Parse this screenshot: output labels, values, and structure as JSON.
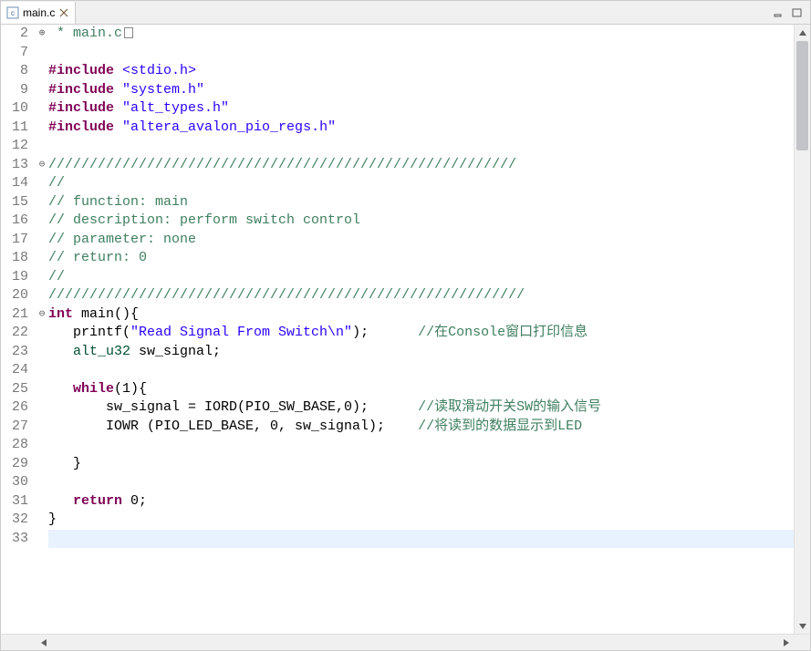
{
  "tab": {
    "filename": "main.c"
  },
  "code": {
    "lines": [
      {
        "n": "2",
        "fold": "plus",
        "tokens": [
          {
            "c": "comment",
            "t": " * main.c"
          }
        ],
        "box": true
      },
      {
        "n": "7",
        "fold": "",
        "tokens": []
      },
      {
        "n": "8",
        "fold": "",
        "tokens": [
          {
            "c": "kw-macro",
            "t": "#include"
          },
          {
            "c": "txt",
            "t": " "
          },
          {
            "c": "inc-sys",
            "t": "<stdio.h>"
          }
        ]
      },
      {
        "n": "9",
        "fold": "",
        "tokens": [
          {
            "c": "kw-macro",
            "t": "#include"
          },
          {
            "c": "txt",
            "t": " "
          },
          {
            "c": "str",
            "t": "\"system.h\""
          }
        ]
      },
      {
        "n": "10",
        "fold": "",
        "tokens": [
          {
            "c": "kw-macro",
            "t": "#include"
          },
          {
            "c": "txt",
            "t": " "
          },
          {
            "c": "str",
            "t": "\"alt_types.h\""
          }
        ]
      },
      {
        "n": "11",
        "fold": "",
        "tokens": [
          {
            "c": "kw-macro",
            "t": "#include"
          },
          {
            "c": "txt",
            "t": " "
          },
          {
            "c": "str",
            "t": "\"altera_avalon_pio_regs.h\""
          }
        ]
      },
      {
        "n": "12",
        "fold": "",
        "tokens": []
      },
      {
        "n": "13",
        "fold": "minus",
        "tokens": [
          {
            "c": "comment",
            "t": "/////////////////////////////////////////////////////////"
          }
        ]
      },
      {
        "n": "14",
        "fold": "",
        "tokens": [
          {
            "c": "comment",
            "t": "//"
          }
        ]
      },
      {
        "n": "15",
        "fold": "",
        "tokens": [
          {
            "c": "comment",
            "t": "// function: main"
          }
        ]
      },
      {
        "n": "16",
        "fold": "",
        "tokens": [
          {
            "c": "comment",
            "t": "// description: perform switch control"
          }
        ]
      },
      {
        "n": "17",
        "fold": "",
        "tokens": [
          {
            "c": "comment",
            "t": "// parameter: none"
          }
        ]
      },
      {
        "n": "18",
        "fold": "",
        "tokens": [
          {
            "c": "comment",
            "t": "// return: 0"
          }
        ]
      },
      {
        "n": "19",
        "fold": "",
        "tokens": [
          {
            "c": "comment",
            "t": "//"
          }
        ]
      },
      {
        "n": "20",
        "fold": "",
        "tokens": [
          {
            "c": "comment",
            "t": "//////////////////////////////////////////////////////////"
          }
        ]
      },
      {
        "n": "21",
        "fold": "minus",
        "tokens": [
          {
            "c": "kw",
            "t": "int"
          },
          {
            "c": "txt",
            "t": " "
          },
          {
            "c": "txt",
            "t": "main(){"
          }
        ]
      },
      {
        "n": "22",
        "fold": "",
        "tokens": [
          {
            "c": "txt",
            "t": "   printf("
          },
          {
            "c": "str",
            "t": "\"Read Signal From Switch\\n\""
          },
          {
            "c": "txt",
            "t": ");      "
          },
          {
            "c": "comment",
            "t": "//在Console窗口打印信息"
          }
        ]
      },
      {
        "n": "23",
        "fold": "",
        "tokens": [
          {
            "c": "txt",
            "t": "   "
          },
          {
            "c": "type",
            "t": "alt_u32"
          },
          {
            "c": "txt",
            "t": " sw_signal;"
          }
        ]
      },
      {
        "n": "24",
        "fold": "",
        "tokens": []
      },
      {
        "n": "25",
        "fold": "",
        "tokens": [
          {
            "c": "txt",
            "t": "   "
          },
          {
            "c": "kw",
            "t": "while"
          },
          {
            "c": "txt",
            "t": "(1){"
          }
        ]
      },
      {
        "n": "26",
        "fold": "",
        "tokens": [
          {
            "c": "txt",
            "t": "       sw_signal = IORD(PIO_SW_BASE,0);      "
          },
          {
            "c": "comment",
            "t": "//读取滑动开关SW的输入信号"
          }
        ]
      },
      {
        "n": "27",
        "fold": "",
        "tokens": [
          {
            "c": "txt",
            "t": "       IOWR (PIO_LED_BASE, 0, sw_signal);    "
          },
          {
            "c": "comment",
            "t": "//将读到的数据显示到LED"
          }
        ]
      },
      {
        "n": "28",
        "fold": "",
        "tokens": []
      },
      {
        "n": "29",
        "fold": "",
        "tokens": [
          {
            "c": "txt",
            "t": "   }"
          }
        ]
      },
      {
        "n": "30",
        "fold": "",
        "tokens": []
      },
      {
        "n": "31",
        "fold": "",
        "tokens": [
          {
            "c": "txt",
            "t": "   "
          },
          {
            "c": "kw",
            "t": "return"
          },
          {
            "c": "txt",
            "t": " 0;"
          }
        ]
      },
      {
        "n": "32",
        "fold": "",
        "tokens": [
          {
            "c": "txt",
            "t": "}"
          }
        ]
      },
      {
        "n": "33",
        "fold": "",
        "tokens": [],
        "hl": true
      }
    ]
  }
}
